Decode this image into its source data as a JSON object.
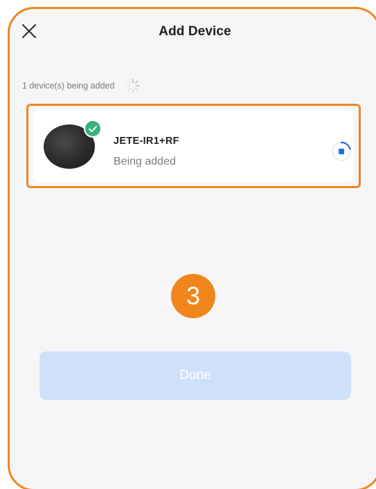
{
  "header": {
    "title": "Add Device",
    "close_icon": "close-icon"
  },
  "status": {
    "text": "1 device(s) being added",
    "spinner_icon": "loading-spinner-icon"
  },
  "device": {
    "name": "JETE-IR1+RF",
    "status": "Being added",
    "badge_icon": "check-icon",
    "progress_icon": "progress-stop-icon"
  },
  "annotation": {
    "step": "3"
  },
  "footer": {
    "done_label": "Done"
  },
  "colors": {
    "highlight": "#f0851c",
    "success": "#36b37e",
    "accent": "#1a73e8",
    "button_disabled": "#cfe0fb"
  }
}
